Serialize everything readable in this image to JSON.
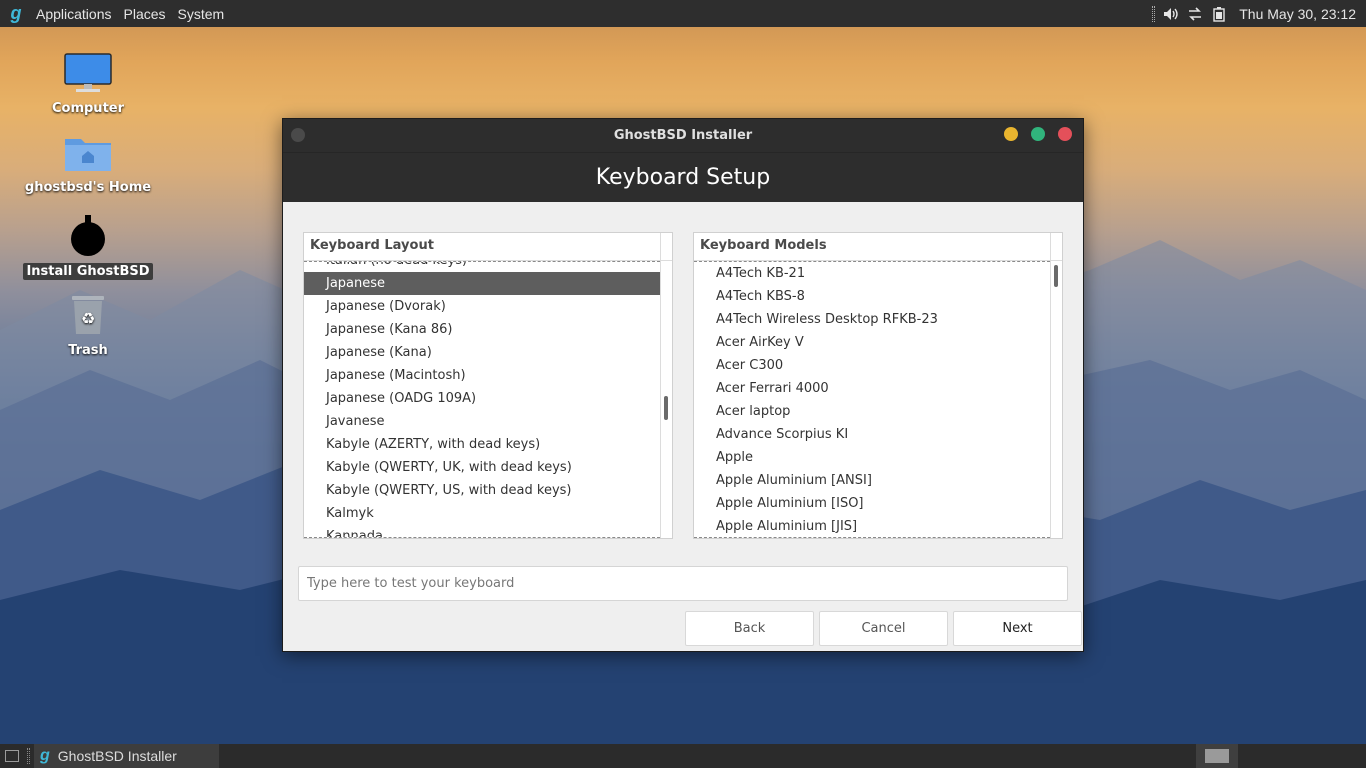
{
  "top_panel": {
    "menus": [
      "Applications",
      "Places",
      "System"
    ],
    "clock": "Thu May 30, 23:12",
    "tray_icons": [
      "volume-icon",
      "network-icon",
      "battery-icon"
    ]
  },
  "desktop": {
    "icons": [
      {
        "label": "Computer",
        "icon": "computer-icon"
      },
      {
        "label": "ghostbsd's Home",
        "icon": "home-folder-icon"
      },
      {
        "label": "Install GhostBSD",
        "icon": "installer-icon"
      },
      {
        "label": "Trash",
        "icon": "trash-icon"
      }
    ]
  },
  "window": {
    "title": "GhostBSD Installer",
    "header": "Keyboard Setup",
    "layout_panel": {
      "heading": "Keyboard Layout",
      "items": [
        "Italian (no dead keys)",
        "Japanese",
        "Japanese (Dvorak)",
        "Japanese (Kana 86)",
        "Japanese (Kana)",
        "Japanese (Macintosh)",
        "Japanese (OADG 109A)",
        "Javanese",
        "Kabyle (AZERTY, with dead keys)",
        "Kabyle (QWERTY, UK, with dead keys)",
        "Kabyle (QWERTY, US, with dead keys)",
        "Kalmyk",
        "Kannada"
      ],
      "selected": "Japanese"
    },
    "models_panel": {
      "heading": "Keyboard Models",
      "items": [
        "A4Tech KB-21",
        "A4Tech KBS-8",
        "A4Tech Wireless Desktop RFKB-23",
        "Acer AirKey V",
        "Acer C300",
        "Acer Ferrari 4000",
        "Acer laptop",
        "Advance Scorpius KI",
        "Apple",
        "Apple Aluminium [ANSI]",
        "Apple Aluminium [ISO]",
        "Apple Aluminium [JIS]"
      ]
    },
    "test_input": {
      "placeholder": "Type here to test your keyboard",
      "value": ""
    },
    "buttons": {
      "back": "Back",
      "cancel": "Cancel",
      "next": "Next"
    }
  },
  "taskbar": {
    "tasks": [
      {
        "label": "GhostBSD Installer",
        "icon": "ghostbsd-icon"
      }
    ]
  },
  "colors": {
    "win_minimize": "#e9b52f",
    "win_maximize": "#31b47c",
    "win_close": "#e4505a",
    "selection": "#5e5e5e",
    "accent_logo": "#3fb8d8"
  }
}
